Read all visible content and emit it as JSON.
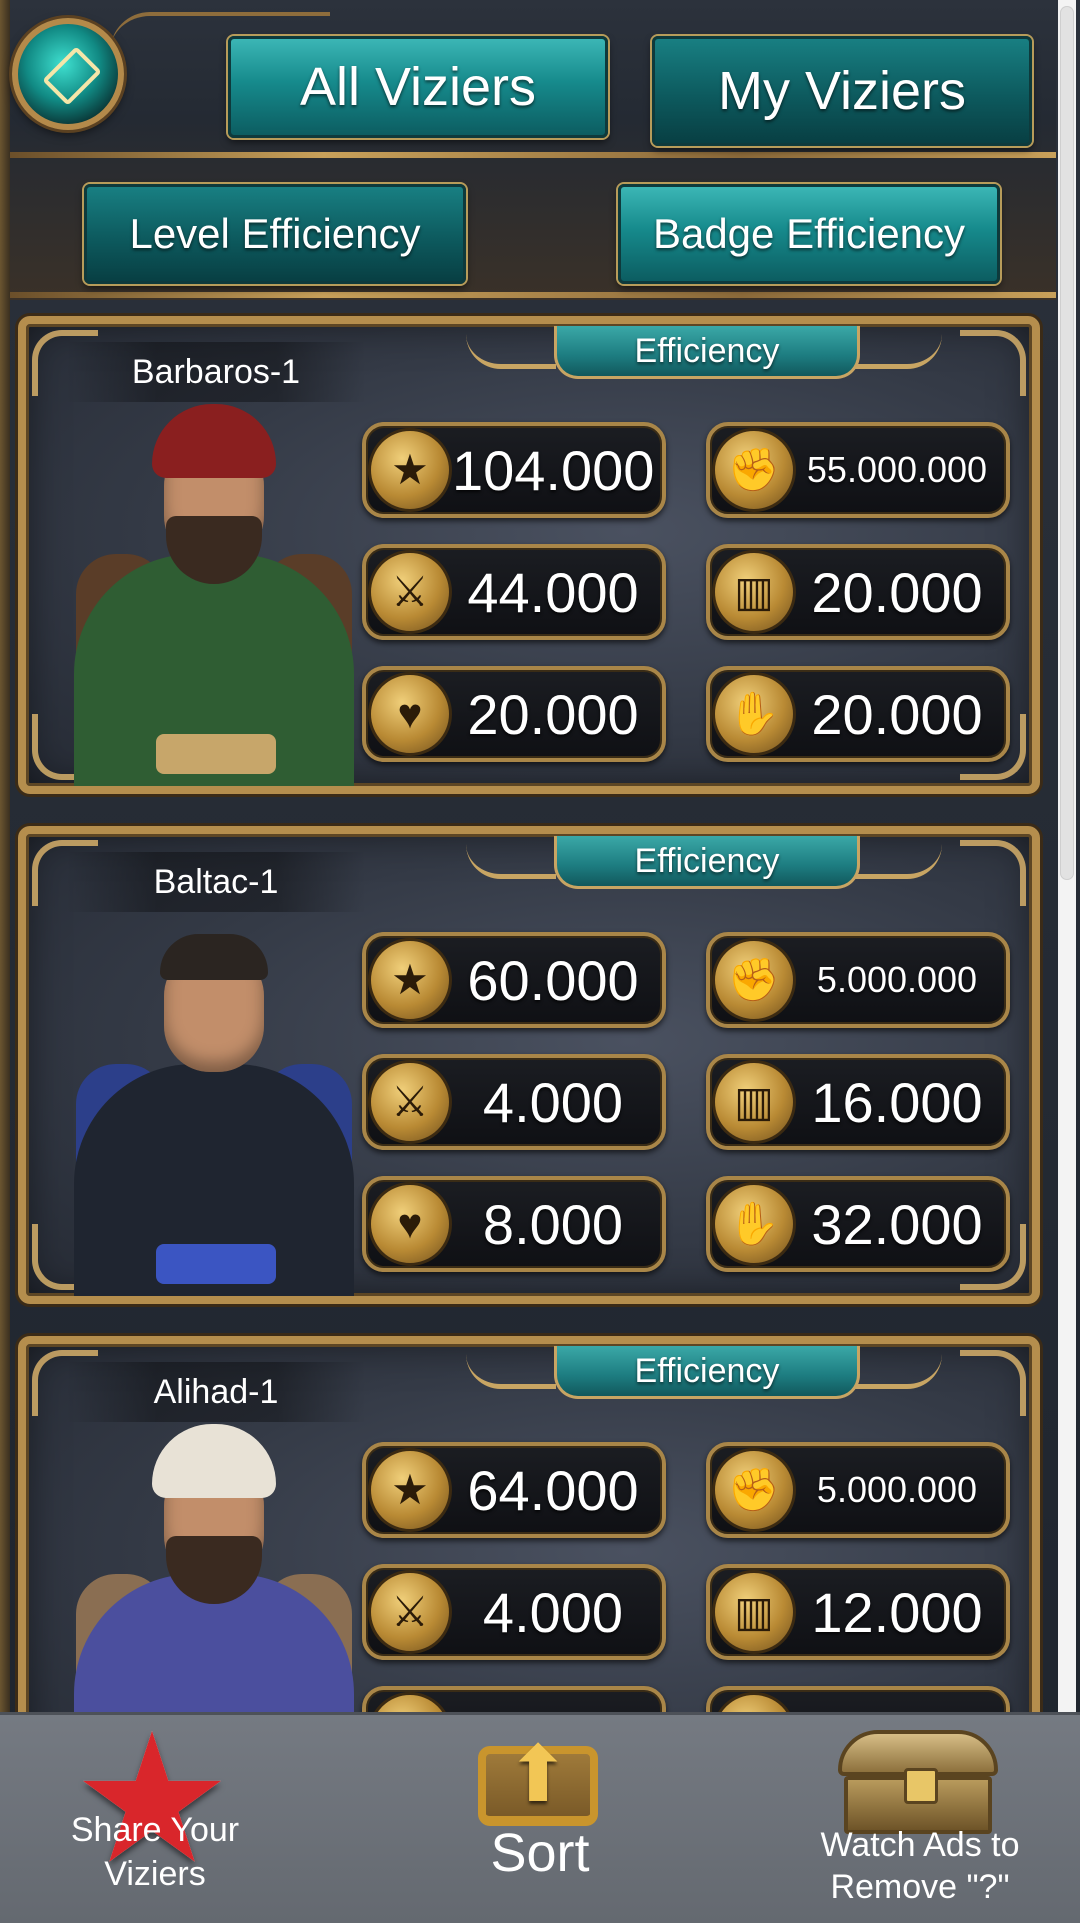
{
  "header": {
    "tabs": [
      {
        "label": "All Viziers"
      },
      {
        "label": "My Viziers"
      }
    ],
    "filters": [
      {
        "label": "Level Efficiency"
      },
      {
        "label": "Badge Efficiency"
      }
    ]
  },
  "cards": [
    {
      "name": "Barbaros-1",
      "banner": "Efficiency",
      "stats": {
        "star": "104.000",
        "fist": "55.000.000",
        "swords": "44.000",
        "book": "20.000",
        "hearts": "20.000",
        "handshake": "20.000"
      },
      "portrait": {
        "hat": "#8a1f1f",
        "robe": "#2f5d33",
        "fur": "#5a3d28",
        "sash": "#c7a66a"
      }
    },
    {
      "name": "Baltac-1",
      "banner": "Efficiency",
      "stats": {
        "star": "60.000",
        "fist": "5.000.000",
        "swords": "4.000",
        "book": "16.000",
        "hearts": "8.000",
        "handshake": "32.000"
      },
      "portrait": {
        "hat": "#2b2521",
        "robe": "#1f2530",
        "fur": "#2c3f8a",
        "sash": "#3b55c2"
      }
    },
    {
      "name": "Alihad-1",
      "banner": "Efficiency",
      "stats": {
        "star": "64.000",
        "fist": "5.000.000",
        "swords": "4.000",
        "book": "12.000"
      },
      "portrait": {
        "hat": "#e8e2d6",
        "robe": "#4b4f9e",
        "fur": "#8a6e52",
        "sash": "#c9a75c"
      }
    }
  ],
  "icons": {
    "star": "star-icon",
    "fist": "fist-icon",
    "swords": "crossed-swords-icon",
    "book": "book-icon",
    "hearts": "hearts-icon",
    "handshake": "handshake-icon"
  },
  "bottom_bar": {
    "share_label": "Share Your Viziers",
    "sort_label": "Sort",
    "watch_label": "Watch Ads to Remove \"?\""
  }
}
